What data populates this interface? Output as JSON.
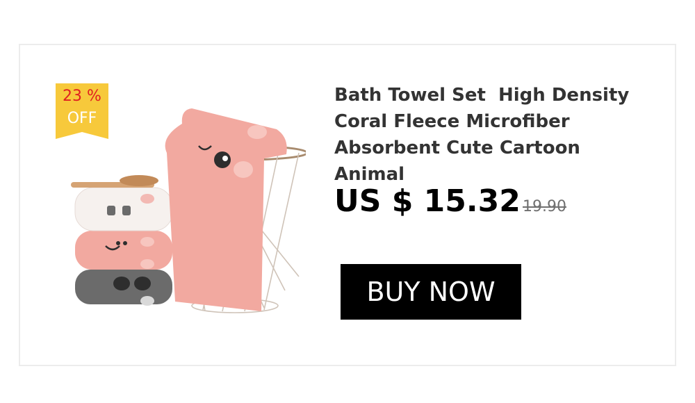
{
  "product": {
    "title": "Bath Towel Set  High Density Coral Fleece Microfiber Absorbent Cute Cartoon Animal",
    "image_alt": "Pink, white and gray cartoon animal bath towels with wooden hair brush and wire basket"
  },
  "discount_badge": {
    "percent": "23 %",
    "label": "OFF",
    "color": "#f7c93b",
    "percent_color": "#e02020"
  },
  "pricing": {
    "current": "US $ 15.32",
    "original": "19.90"
  },
  "cta": {
    "label": "BUY NOW"
  },
  "colors": {
    "towel_pink": "#f2a9a0",
    "towel_white": "#f6f1ee",
    "towel_gray": "#6b6b6b",
    "button_bg": "#000000"
  }
}
